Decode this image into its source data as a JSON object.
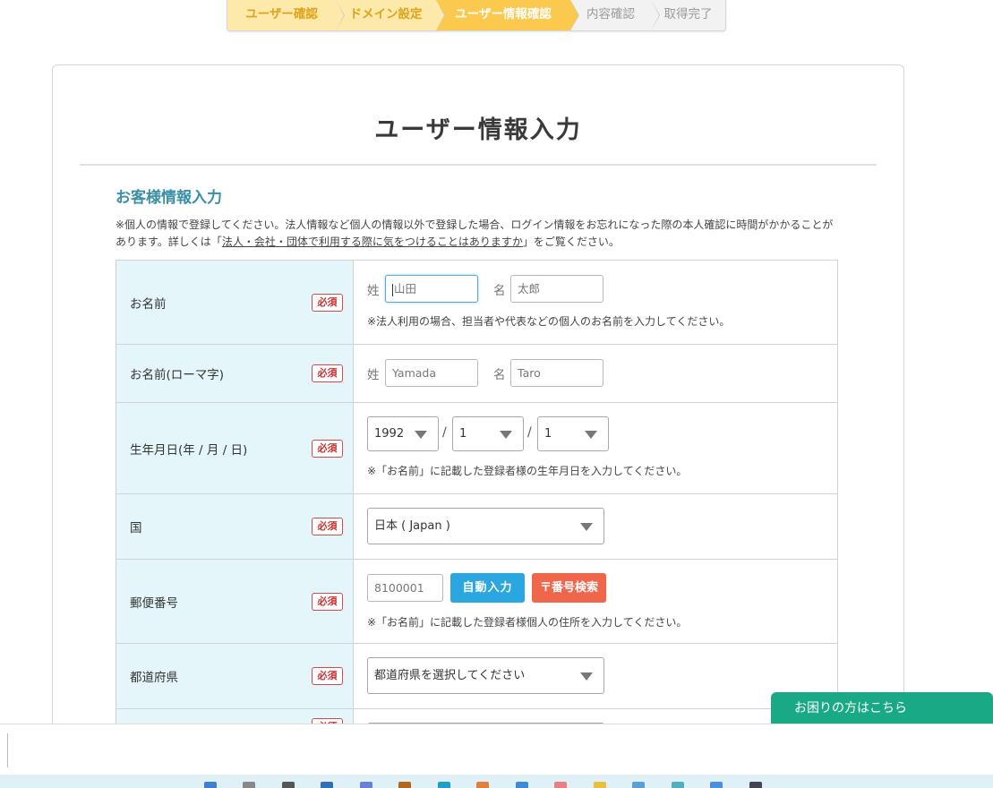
{
  "stepper": {
    "steps": [
      {
        "label": "ユーザー確認",
        "state": "done"
      },
      {
        "label": "ドメイン設定",
        "state": "done"
      },
      {
        "label": "ユーザー情報確認",
        "state": "current"
      },
      {
        "label": "内容確認",
        "state": "todo"
      },
      {
        "label": "取得完了",
        "state": "todo"
      }
    ]
  },
  "page": {
    "title": "ユーザー情報入力",
    "section_title": "お客様情報入力",
    "note_before": "※個人の情報で登録してください。法人情報など個人の情報以外で登録した場合、ログイン情報をお忘れになった際の本人確認に時間がかかることがあります。詳しくは「",
    "note_link": "法人・会社・団体で利用する際に気をつけることはありますか",
    "note_after": "」をご覧ください。"
  },
  "form": {
    "required_label": "必須",
    "name": {
      "label": "お名前",
      "last_label": "姓",
      "last_placeholder": "山田",
      "first_label": "名",
      "first_placeholder": "太郎",
      "help": "※法人利用の場合、担当者や代表などの個人のお名前を入力してください。"
    },
    "name_roman": {
      "label": "お名前(ローマ字)",
      "last_label": "姓",
      "last_placeholder": "Yamada",
      "first_label": "名",
      "first_placeholder": "Taro"
    },
    "birthdate": {
      "label": "生年月日(年 / 月 / 日)",
      "year": "1992",
      "month": "1",
      "day": "1",
      "sep": "/",
      "help": "※「お名前」に記載した登録者様の生年月日を入力してください。"
    },
    "country": {
      "label": "国",
      "value": "日本 ( Japan )"
    },
    "postal": {
      "label": "郵便番号",
      "placeholder": "8100001",
      "auto_button": "自動入力",
      "search_button": "〒番号検索",
      "help": "※「お名前」に記載した登録者様個人の住所を入力してください。"
    },
    "prefecture": {
      "label": "都道府県",
      "value": "都道府県を選択してください"
    }
  },
  "help_widget": {
    "label": "お困りの方はこちら"
  }
}
